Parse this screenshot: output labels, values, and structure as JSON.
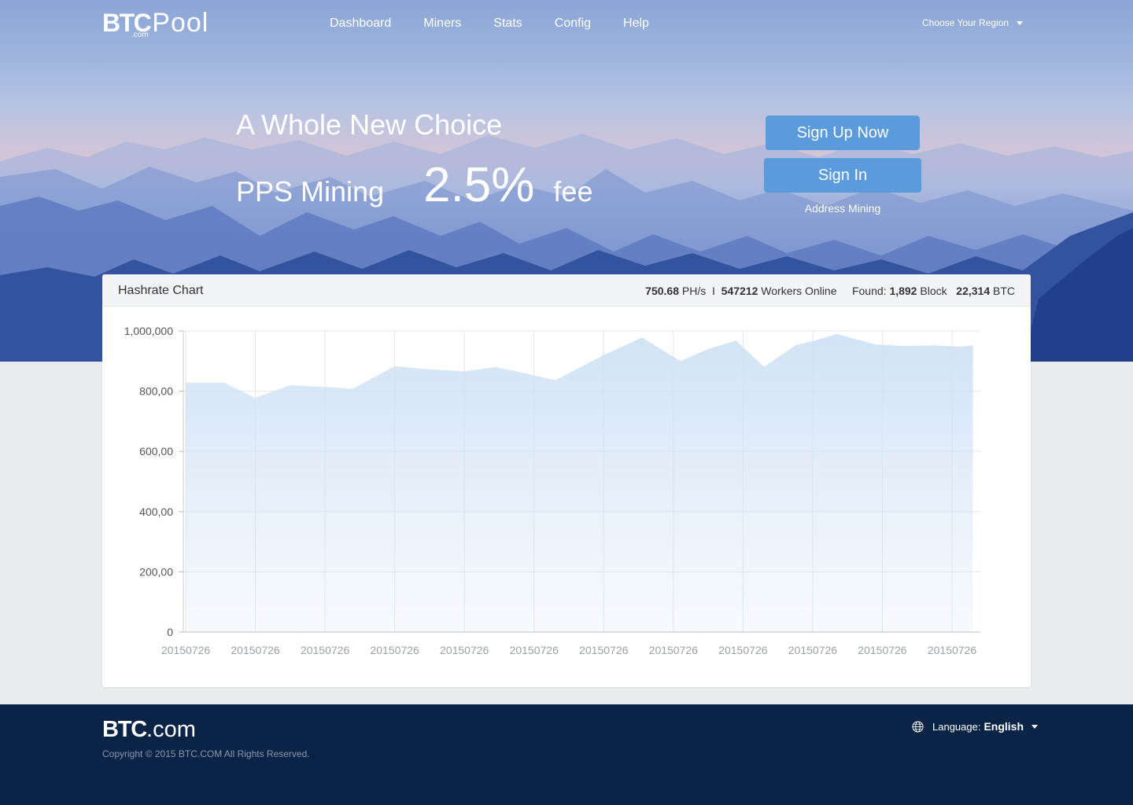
{
  "brand": {
    "logo_btc": "BTC",
    "logo_pool": "Pool",
    "logo_dotcom": ".com"
  },
  "nav": {
    "items": [
      "Dashboard",
      "Miners",
      "Stats",
      "Config",
      "Help"
    ]
  },
  "region": {
    "label": "Choose Your Region",
    "icon": "chevron-down-icon"
  },
  "hero": {
    "headline": "A Whole New Choice",
    "pps_label": "PPS Mining",
    "fee_value": "2.5%",
    "fee_label": "fee",
    "signup_label": "Sign Up Now",
    "signin_label": "Sign In",
    "address_mining_label": "Address Mining"
  },
  "card": {
    "title": "Hashrate Chart",
    "hashrate_value": "750.68",
    "hashrate_unit": "PH/s",
    "separator": "I",
    "workers_value": "547212",
    "workers_label": "Workers Online",
    "found_label": "Found:",
    "blocks_value": "1,892",
    "blocks_label": "Block",
    "btc_value": "22,314",
    "btc_label": "BTC"
  },
  "chart_data": {
    "type": "area",
    "title": "Hashrate Chart",
    "xlabel": "",
    "ylabel": "",
    "ylim": [
      0,
      1000000
    ],
    "yticks": [
      0,
      200000,
      400000,
      600000,
      800000,
      1000000
    ],
    "ytick_labels": [
      "0",
      "200,00",
      "400,00",
      "600,00",
      "800,00",
      "1,000,000"
    ],
    "categories": [
      "20150726",
      "20150726",
      "20150726",
      "20150726",
      "20150726",
      "20150726",
      "20150726",
      "20150726",
      "20150726",
      "20150726",
      "20150726",
      "20150726"
    ],
    "x": [
      0,
      0.55,
      1,
      1.5,
      2,
      2.4,
      3,
      3.4,
      4,
      4.45,
      4.9,
      5.3,
      6,
      6.55,
      7.1,
      7.5,
      7.9,
      8.3,
      8.75,
      9,
      9.35,
      9.9,
      10.3,
      10.75,
      11.1,
      11.3
    ],
    "values": [
      828000,
      828000,
      778000,
      820000,
      814000,
      808000,
      883000,
      874000,
      866000,
      880000,
      858000,
      836000,
      920000,
      978000,
      900000,
      940000,
      968000,
      881000,
      952000,
      966000,
      990000,
      955000,
      950000,
      952000,
      948000,
      952000
    ],
    "grid": true,
    "fill_color": "#cfe1f4",
    "legend": "none"
  },
  "footer": {
    "logo_btc": "BTC",
    "logo_com": ".com",
    "copyright": "Copyright © 2015 BTC.COM All Rights Reserved.",
    "language_label": "Language:",
    "language_value": "English"
  },
  "colors": {
    "accent": "#5b9bdc",
    "footer_bg": "#0a2447",
    "page_bg": "#e9ebef"
  }
}
